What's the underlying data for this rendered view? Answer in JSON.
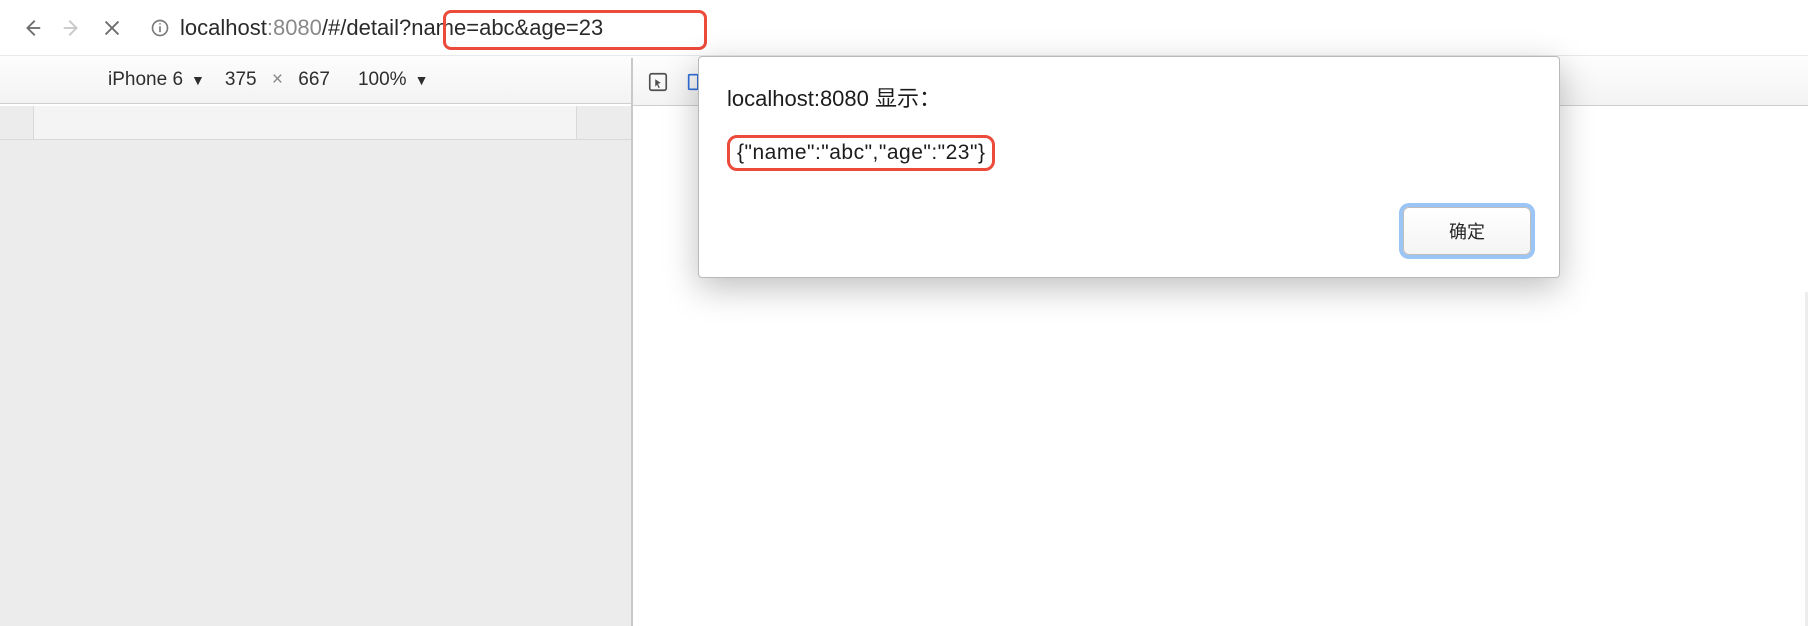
{
  "toolbar": {
    "url_host": "localhost",
    "url_port": ":8080",
    "url_path": "/#/detail?",
    "url_query": "name=abc&age=23"
  },
  "device_toolbar": {
    "device": "iPhone 6",
    "width": "375",
    "height": "667",
    "zoom": "100%"
  },
  "dialog": {
    "title": "localhost:8080 显示：",
    "body": "{\"name\":\"abc\",\"age\":\"23\"}",
    "ok_label": "确定"
  },
  "highlight_color": "#ec4a3a"
}
